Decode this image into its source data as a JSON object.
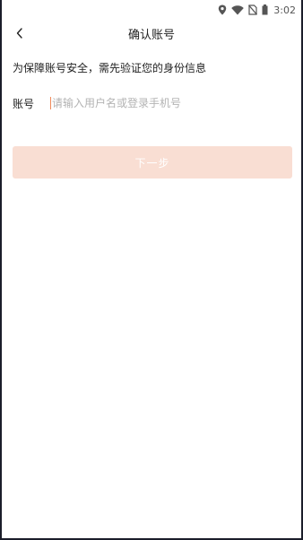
{
  "status_bar": {
    "time": "3:02",
    "icons": [
      "location-icon",
      "wifi-icon",
      "no-sim-icon",
      "battery-icon"
    ]
  },
  "nav": {
    "back_icon": "chevron-left-icon",
    "title": "确认账号"
  },
  "hint": "为保障账号安全，需先验证您的身份信息",
  "account": {
    "label": "账号",
    "value": "",
    "placeholder": "请输入用户名或登录手机号"
  },
  "next_button": {
    "label": "下一步",
    "enabled": false
  },
  "colors": {
    "background": "#ffffff",
    "text": "#222222",
    "placeholder": "#b3b3b3",
    "button_disabled_bg": "#f9ded3",
    "caret": "#f08a5a",
    "frame": "#1b1d2a"
  }
}
